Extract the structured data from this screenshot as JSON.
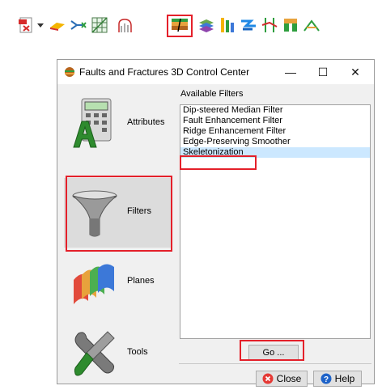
{
  "toolbar": {
    "icons": [
      "pdf-export-icon",
      "surface-icon",
      "horizon-tracking-icon",
      "grid-mesh-icon",
      "seismic-attribute-icon",
      "faults-fractures-icon",
      "layer-stack-icon",
      "well-log-icon",
      "flow-arrow-icon",
      "fault-sticks-icon",
      "wheeler-icon",
      "sediment-icon"
    ]
  },
  "window": {
    "title": "Faults and Fractures 3D Control Center",
    "minimize_glyph": "—",
    "maximize_glyph": "☐",
    "close_glyph": "✕"
  },
  "left_panel": {
    "items": [
      {
        "label": "Attributes",
        "icon": "calculator-a-icon"
      },
      {
        "label": "Filters",
        "icon": "funnel-icon"
      },
      {
        "label": "Planes",
        "icon": "planes-icon"
      },
      {
        "label": "Tools",
        "icon": "wrench-screwdriver-icon"
      }
    ]
  },
  "filters": {
    "heading": "Available Filters",
    "items": [
      "Dip-steered Median Filter",
      "Fault Enhancement Filter",
      "Ridge Enhancement Filter",
      "Edge-Preserving Smoother",
      "Skeletonization"
    ],
    "selected": "Skeletonization"
  },
  "buttons": {
    "go": "Go ...",
    "close": "Close",
    "help": "Help"
  },
  "colors": {
    "highlight_red": "#e4202a",
    "selection_blue": "#cce8ff"
  }
}
